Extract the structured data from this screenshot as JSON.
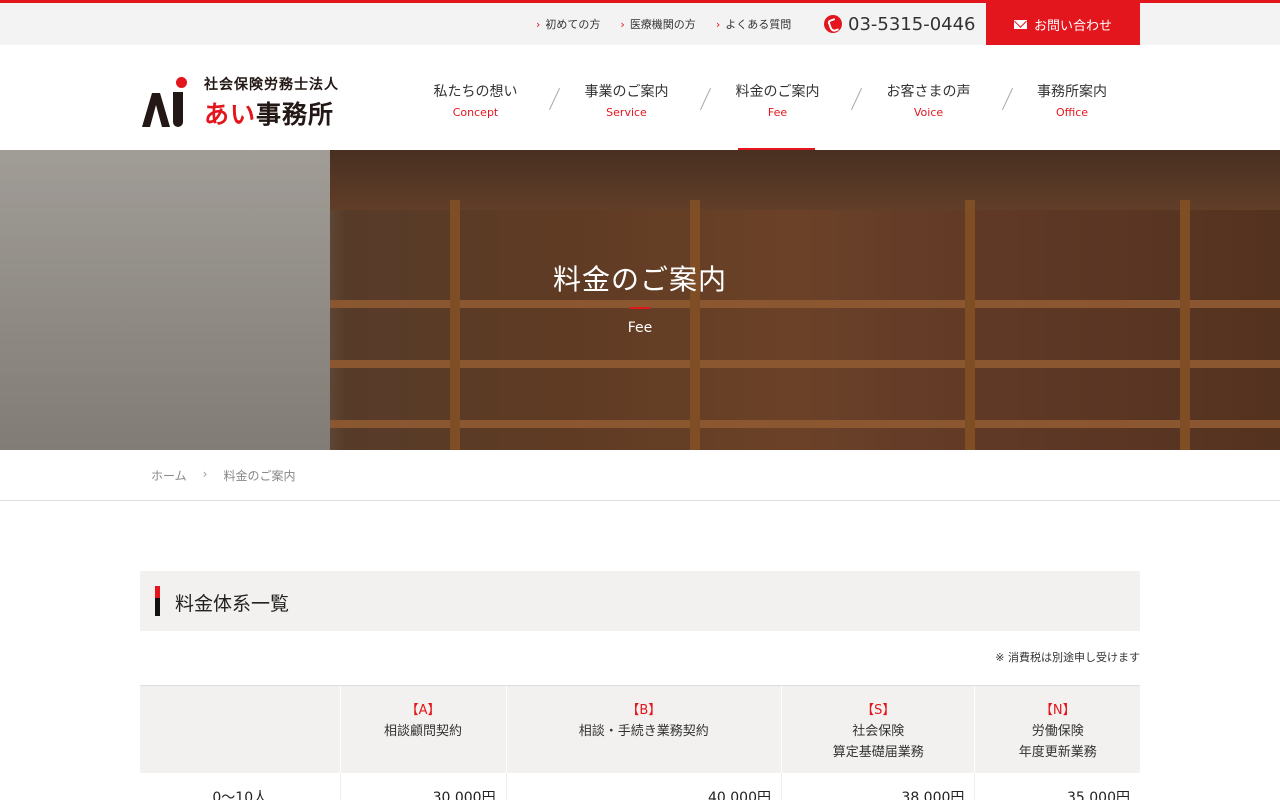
{
  "topbar": {
    "links": [
      {
        "label": "初めての方"
      },
      {
        "label": "医療機関の方"
      },
      {
        "label": "よくある質問"
      }
    ],
    "phone": "03-5315-0446",
    "contact_label": "お問い合わせ"
  },
  "logo": {
    "sub": "社会保険労務士法人",
    "main_red": "あい",
    "main_black": "事務所"
  },
  "nav": [
    {
      "jp": "私たちの想い",
      "en": "Concept"
    },
    {
      "jp": "事業のご案内",
      "en": "Service"
    },
    {
      "jp": "料金のご案内",
      "en": "Fee"
    },
    {
      "jp": "お客さまの声",
      "en": "Voice"
    },
    {
      "jp": "事務所案内",
      "en": "Office"
    }
  ],
  "hero": {
    "title": "料金のご案内",
    "subtitle": "Fee"
  },
  "breadcrumb": {
    "home": "ホーム",
    "current": "料金のご案内"
  },
  "section": {
    "title": "料金体系一覧",
    "tax_note": "※ 消費税は別途申し受けます"
  },
  "table": {
    "headers": [
      {
        "code": "",
        "line1": "",
        "line2": ""
      },
      {
        "code": "【A】",
        "line1": "相談顧問契約",
        "line2": ""
      },
      {
        "code": "【B】",
        "line1": "相談・手続き業務契約",
        "line2": ""
      },
      {
        "code": "【S】",
        "line1": "社会保険",
        "line2": "算定基礎届業務"
      },
      {
        "code": "【N】",
        "line1": "労働保険",
        "line2": "年度更新業務"
      }
    ],
    "rows": [
      [
        "0〜10人",
        "30,000円",
        "40,000円",
        "38,000円",
        "35,000円"
      ]
    ]
  },
  "colors": {
    "accent": "#e3161d",
    "panel": "#f2f1ef"
  }
}
